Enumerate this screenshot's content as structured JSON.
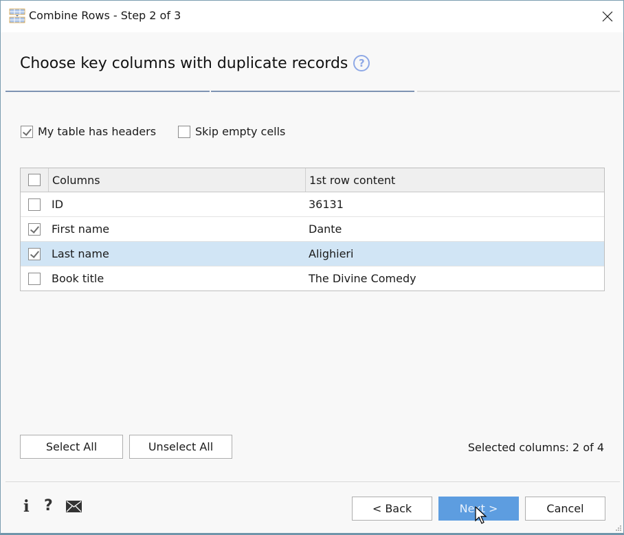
{
  "window": {
    "title": "Combine Rows - Step 2 of 3",
    "icon": "table-icon",
    "close_icon": "close-icon"
  },
  "header": {
    "heading": "Choose key columns with duplicate records",
    "help_glyph": "?",
    "steps_total": 3,
    "current_step": 2
  },
  "options": {
    "has_headers": {
      "label": "My table has headers",
      "checked": true
    },
    "skip_empty": {
      "label": "Skip empty cells",
      "checked": false
    }
  },
  "grid": {
    "headers": {
      "select_all_checked": false,
      "columns": "Columns",
      "content": "1st row content"
    },
    "rows": [
      {
        "column": "ID",
        "content": "36131",
        "checked": false,
        "selected": false
      },
      {
        "column": "First name",
        "content": "Dante",
        "checked": true,
        "selected": false
      },
      {
        "column": "Last name",
        "content": "Alighieri",
        "checked": true,
        "selected": true
      },
      {
        "column": "Book title",
        "content": "The Divine Comedy",
        "checked": false,
        "selected": false
      }
    ]
  },
  "actions": {
    "select_all": "Select All",
    "unselect_all": "Unselect All",
    "selected_count": "Selected columns: 2 of 4"
  },
  "footer": {
    "info_glyph": "i",
    "help_glyph": "?",
    "back": "< Back",
    "next": "Next >",
    "cancel": "Cancel"
  },
  "colors": {
    "accent": "#5d9de0",
    "selected_row": "#d1e5f5",
    "step_active": "#7d93b2",
    "help_icon": "#8ea8e6"
  }
}
